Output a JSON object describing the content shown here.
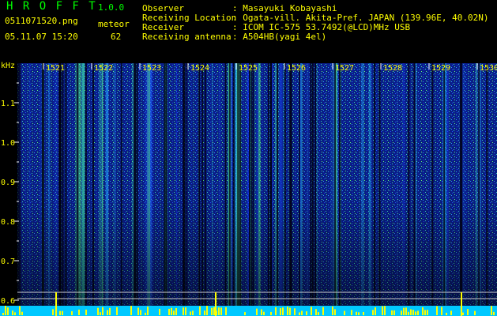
{
  "header": {
    "app_title": "H R O F F T",
    "app_version": "1.0.0",
    "filename": "0511071520.png",
    "mode": "meteor",
    "datetime": "05.11.07 15:20",
    "count": "62",
    "info": [
      {
        "label": "Observer",
        "value": ": Masayuki Kobayashi"
      },
      {
        "label": "Receiving Location",
        "value": ": Ogata-vill. Akita-Pref. JAPAN (139.96E, 40.02N)"
      },
      {
        "label": "Receiver",
        "value": ": ICOM IC-575 53.7492(@LCD)MHz USB"
      },
      {
        "label": "Receiving antenna",
        "value": ": A504HB(yagi 4el)"
      }
    ]
  },
  "spectrogram": {
    "y_unit": "kHz",
    "y_ticks": [
      "1.1",
      "1.0",
      "0.9",
      "0.8",
      "0.7",
      "0.6"
    ],
    "x_ticks": [
      "1521",
      "1522",
      "1523",
      "1524",
      "1525",
      "1526",
      "1527",
      "1528",
      "1529",
      "1530"
    ],
    "colors": {
      "label": "#ffff00",
      "tick": "#ffffff",
      "line": "#cccccc"
    }
  }
}
